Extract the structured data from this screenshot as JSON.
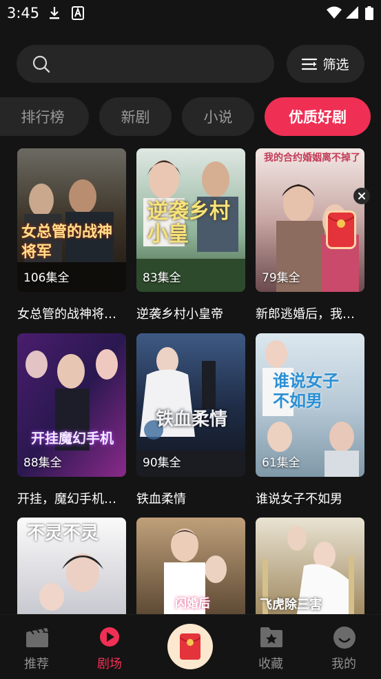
{
  "status_bar": {
    "time": "3:45"
  },
  "search": {
    "placeholder": "",
    "filter_label": "筛选"
  },
  "tabs": [
    {
      "label": "排行榜",
      "active": false
    },
    {
      "label": "新剧",
      "active": false
    },
    {
      "label": "小说",
      "active": false
    },
    {
      "label": "优质好剧",
      "active": true
    }
  ],
  "cards": [
    {
      "title": "女总管的战神将…",
      "episodes": "106集全",
      "poster_text": "女总管的战神将军"
    },
    {
      "title": "逆袭乡村小皇帝",
      "episodes": "83集全",
      "poster_text": "逆袭乡村小皇"
    },
    {
      "title": "新郎逃婚后，我…",
      "episodes": "79集全",
      "poster_text": "我的合约婚姻离不掉了"
    },
    {
      "title": "开挂，魔幻手机…",
      "episodes": "88集全",
      "poster_text": "开挂魔幻手机"
    },
    {
      "title": "铁血柔情",
      "episodes": "90集全",
      "poster_text": "铁血柔情"
    },
    {
      "title": "谁说女子不如男",
      "episodes": "61集全",
      "poster_text": "谁说女子不如男"
    },
    {
      "title": "",
      "episodes": "",
      "poster_text": "不灵不灵"
    },
    {
      "title": "",
      "episodes": "",
      "poster_text": "闪婚后"
    },
    {
      "title": "",
      "episodes": "",
      "poster_text": "飞虎除三害"
    }
  ],
  "bottom_nav": [
    {
      "label": "推荐",
      "icon": "clapperboard-icon",
      "active": false
    },
    {
      "label": "剧场",
      "icon": "play-circle-icon",
      "active": true
    },
    {
      "label": "",
      "icon": "red-envelope-icon",
      "active": false
    },
    {
      "label": "收藏",
      "icon": "folder-star-icon",
      "active": false
    },
    {
      "label": "我的",
      "icon": "smiley-icon",
      "active": false
    }
  ],
  "colors": {
    "accent": "#ef2f54",
    "background": "#141414",
    "surface": "#262626"
  }
}
